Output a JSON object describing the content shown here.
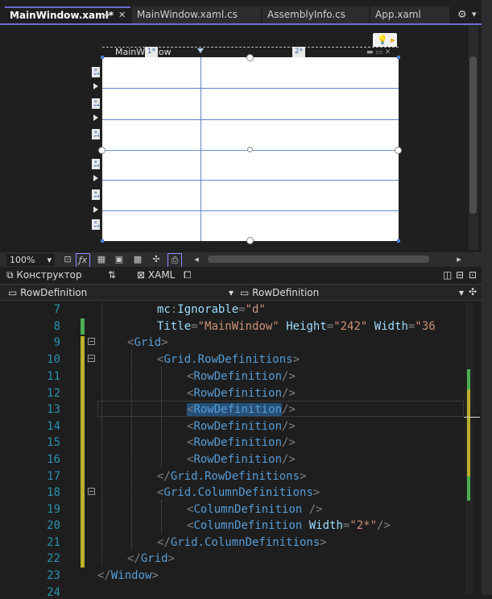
{
  "tabs": [
    {
      "label": "MainWindow.xaml*",
      "active": true
    },
    {
      "label": "MainWindow.xaml.cs",
      "active": false
    },
    {
      "label": "AssemblyInfo.cs",
      "active": false
    },
    {
      "label": "App.xaml",
      "active": false
    }
  ],
  "tab_icons": {
    "pin": "⊸",
    "close": "✕",
    "gear": "⚙",
    "dropdown": "▾"
  },
  "designer": {
    "window_title": "MainWindow",
    "row_markers": [
      "1*",
      "1*",
      "1*",
      "1*",
      "1*",
      "1*",
      "1*"
    ],
    "col_markers": [
      "1*",
      "2*"
    ],
    "zoom": "100%"
  },
  "split_tabs": {
    "designer": "Конструктор",
    "swap": "⇅",
    "xaml": "XAML"
  },
  "navbar": {
    "left": "RowDefinition",
    "right": "RowDefinition"
  },
  "editor": {
    "line_numbers": [
      "7",
      "8",
      "9",
      "10",
      "11",
      "12",
      "13",
      "14",
      "15",
      "16",
      "17",
      "18",
      "19",
      "20",
      "21",
      "22",
      "23",
      "24"
    ],
    "lines": {
      "l7": {
        "ns": "mc",
        "attr": "Ignorable",
        "val": "\"d\""
      },
      "l8": {
        "a1": "Title",
        "v1": "\"MainWindow\"",
        "a2": "Height",
        "v2": "\"242\"",
        "a3": "Width",
        "v3": "\"36"
      },
      "l9": "Grid",
      "l10": "Grid.RowDefinitions",
      "row_def": "RowDefinition",
      "l17": "Grid.RowDefinitions",
      "l18": "Grid.ColumnDefinitions",
      "col_def": "ColumnDefinition",
      "l20_attr": "Width",
      "l20_val": "\"2*\"",
      "l21": "Grid.ColumnDefinitions",
      "l22": "Grid",
      "l23": "Window"
    }
  },
  "colors": {
    "accent": "#6f6fd6",
    "grid_line": "#5b86c7",
    "line_number": "#2b91af",
    "xml_element": "#569cd6",
    "xml_attr": "#9cdcfe",
    "xml_string": "#ce9178"
  }
}
